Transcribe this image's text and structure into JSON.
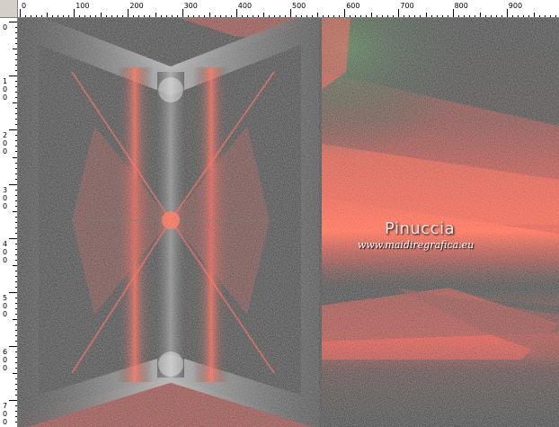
{
  "ruler": {
    "top_labels": [
      "0",
      "100",
      "200",
      "300",
      "400",
      "500",
      "600",
      "700",
      "800",
      "900"
    ],
    "left_labels": [
      "0",
      "100",
      "200",
      "300",
      "400",
      "500",
      "600",
      "700"
    ]
  },
  "artwork": {
    "colors": {
      "dark": "#1a1a1a",
      "red": "#d8321a",
      "orange": "#ff5a1e",
      "green": "#1f5a24",
      "grey": "#8a8a8a",
      "frame_light": "#b4b4b4"
    }
  },
  "watermark": {
    "title": "Pinuccia",
    "url": "www.maidiregrafica.eu"
  }
}
